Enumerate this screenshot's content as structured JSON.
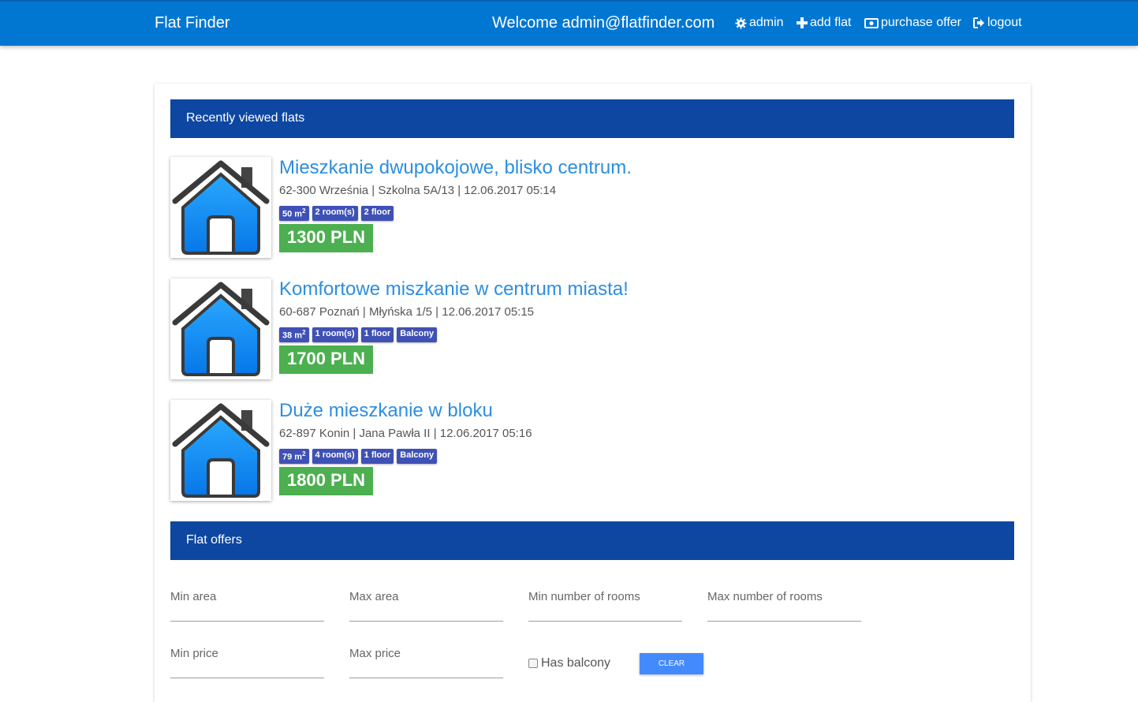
{
  "nav": {
    "brand": "Flat Finder",
    "welcome": "Welcome admin@flatfinder.com",
    "links": [
      {
        "label": "admin",
        "icon": "gear-icon"
      },
      {
        "label": "add flat",
        "icon": "plus-icon"
      },
      {
        "label": "purchase offer",
        "icon": "money-icon"
      },
      {
        "label": "logout",
        "icon": "logout-icon"
      }
    ]
  },
  "recent": {
    "heading": "Recently viewed flats",
    "flats": [
      {
        "title": "Mieszkanie dwupokojowe, blisko centrum.",
        "meta": "62-300 Września | Szkolna 5A/13 | 12.06.2017 05:14",
        "area": "50 m",
        "rooms": "2 room(s)",
        "floor": "2 floor",
        "balcony": "",
        "price": "1300 PLN"
      },
      {
        "title": "Komfortowe miszkanie w centrum miasta!",
        "meta": "60-687 Poznań | Młyńska 1/5 | 12.06.2017 05:15",
        "area": "38 m",
        "rooms": "1 room(s)",
        "floor": "1 floor",
        "balcony": "Balcony",
        "price": "1700 PLN"
      },
      {
        "title": "Duże mieszkanie w bloku",
        "meta": "62-897 Konin | Jana Pawła II | 12.06.2017 05:16",
        "area": "79 m",
        "rooms": "4 room(s)",
        "floor": "1 floor",
        "balcony": "Balcony",
        "price": "1800 PLN"
      }
    ]
  },
  "offers": {
    "heading": "Flat offers",
    "filters": {
      "min_area": "Min area",
      "max_area": "Max area",
      "min_rooms": "Min number of rooms",
      "max_rooms": "Max number of rooms",
      "min_price": "Min price",
      "max_price": "Max price",
      "has_balcony": "Has balcony",
      "clear": "CLEAR"
    }
  },
  "colors": {
    "topbar": "#0277d2",
    "section_head": "#0d47a1",
    "badge": "#3f51b5",
    "price": "#4caf50",
    "link": "#2c8ee0",
    "clear_button": "#448aff"
  }
}
